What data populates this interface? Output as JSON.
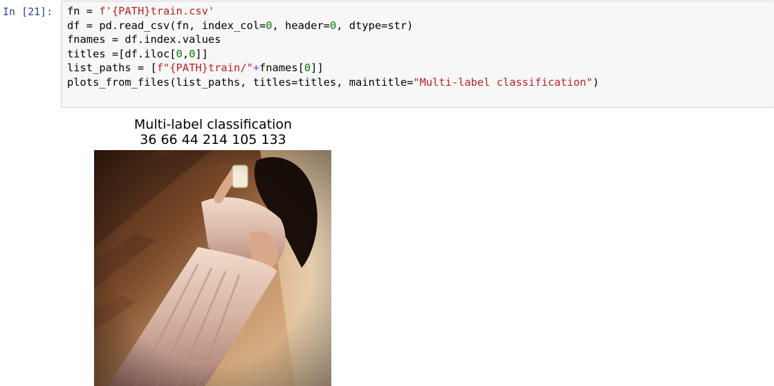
{
  "cell": {
    "prompt": "In [21]:",
    "code": {
      "line1": {
        "a": "fn = ",
        "s1": "f'{PATH}train.csv'"
      },
      "line2": {
        "a": "df = pd.read_csv(fn, index_col=",
        "n1": "0",
        "b": ", header=",
        "n2": "0",
        "c": ", dtype=str)"
      },
      "line3": {
        "a": "fnames = df.index.values"
      },
      "line4": {
        "a": "titles =[df.iloc[",
        "n1": "0",
        "b": ",",
        "n2": "0",
        "c": "]]"
      },
      "line5": {
        "a": "list_paths = [",
        "s1": "f\"{PATH}train/\"",
        "op": "+",
        "b": "fnames[",
        "n1": "0",
        "c": "]]"
      },
      "line6": {
        "a": "plots_from_files(list_paths, titles=titles, maintitle=",
        "s1": "\"Multi-label classification\"",
        "b": ")"
      }
    }
  },
  "output": {
    "figure": {
      "title": "Multi-label classification",
      "subtitle": "36 66 44 214 105 133"
    }
  },
  "colors": {
    "prompt": "#303f9f",
    "string": "#ba2121",
    "number": "#008000",
    "operator": "#aa22ff",
    "cell_background": "#f7f7f7",
    "cell_border": "#cfcfcf"
  }
}
